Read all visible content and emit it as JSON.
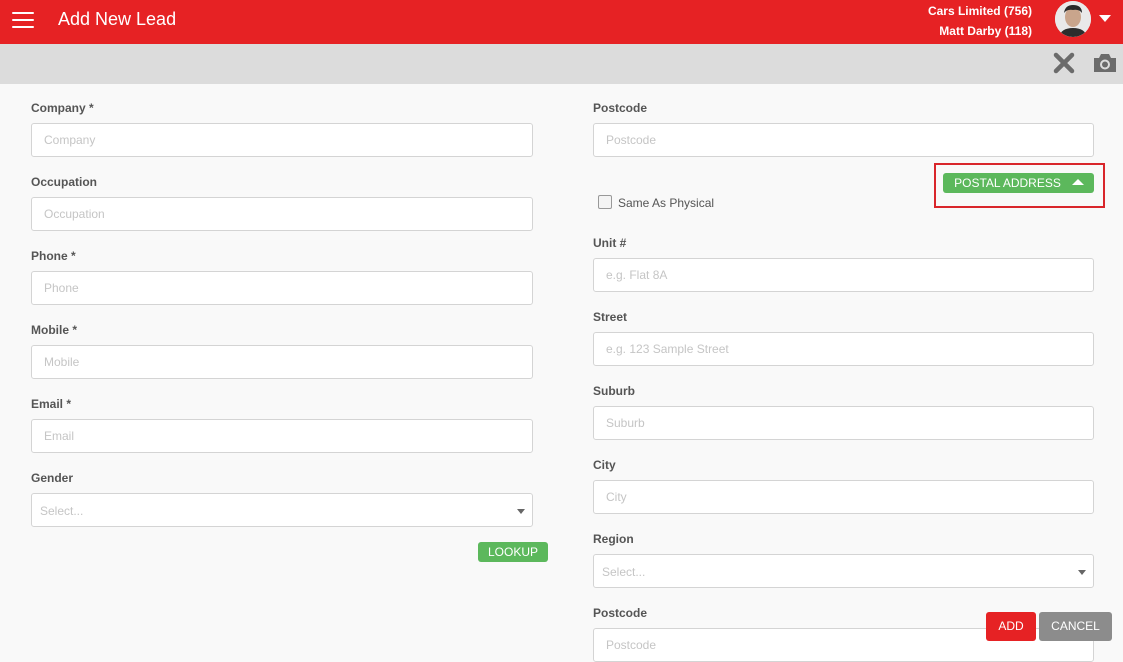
{
  "header": {
    "title": "Add New Lead",
    "company": "Cars Limited (756)",
    "user": "Matt Darby (118)"
  },
  "colors": {
    "brand_red": "#e62224",
    "button_green": "#5cb85c",
    "cancel_gray": "#8c8c8c"
  },
  "icons": [
    "menu-icon",
    "close-icon",
    "camera-icon",
    "chevron-down-icon",
    "caret-up-icon"
  ],
  "left_form": {
    "company": {
      "label": "Company *",
      "placeholder": "Company",
      "value": ""
    },
    "occupation": {
      "label": "Occupation",
      "placeholder": "Occupation",
      "value": ""
    },
    "phone": {
      "label": "Phone *",
      "placeholder": "Phone",
      "value": ""
    },
    "mobile": {
      "label": "Mobile *",
      "placeholder": "Mobile",
      "value": ""
    },
    "email": {
      "label": "Email *",
      "placeholder": "Email",
      "value": ""
    },
    "gender": {
      "label": "Gender",
      "placeholder": "Select..."
    },
    "lookup_label": "LOOKUP"
  },
  "right_form": {
    "postcode_top": {
      "label": "Postcode",
      "placeholder": "Postcode",
      "value": ""
    },
    "postal_address_label": "POSTAL ADDRESS",
    "same_as_physical": {
      "label": "Same As Physical",
      "checked": false
    },
    "unit": {
      "label": "Unit #",
      "placeholder": "e.g. Flat 8A",
      "value": ""
    },
    "street": {
      "label": "Street",
      "placeholder": "e.g. 123 Sample Street",
      "value": ""
    },
    "suburb": {
      "label": "Suburb",
      "placeholder": "Suburb",
      "value": ""
    },
    "city": {
      "label": "City",
      "placeholder": "City",
      "value": ""
    },
    "region": {
      "label": "Region",
      "placeholder": "Select..."
    },
    "postcode_bottom": {
      "label": "Postcode",
      "placeholder": "Postcode",
      "value": ""
    }
  },
  "actions": {
    "add_label": "ADD",
    "cancel_label": "CANCEL"
  }
}
